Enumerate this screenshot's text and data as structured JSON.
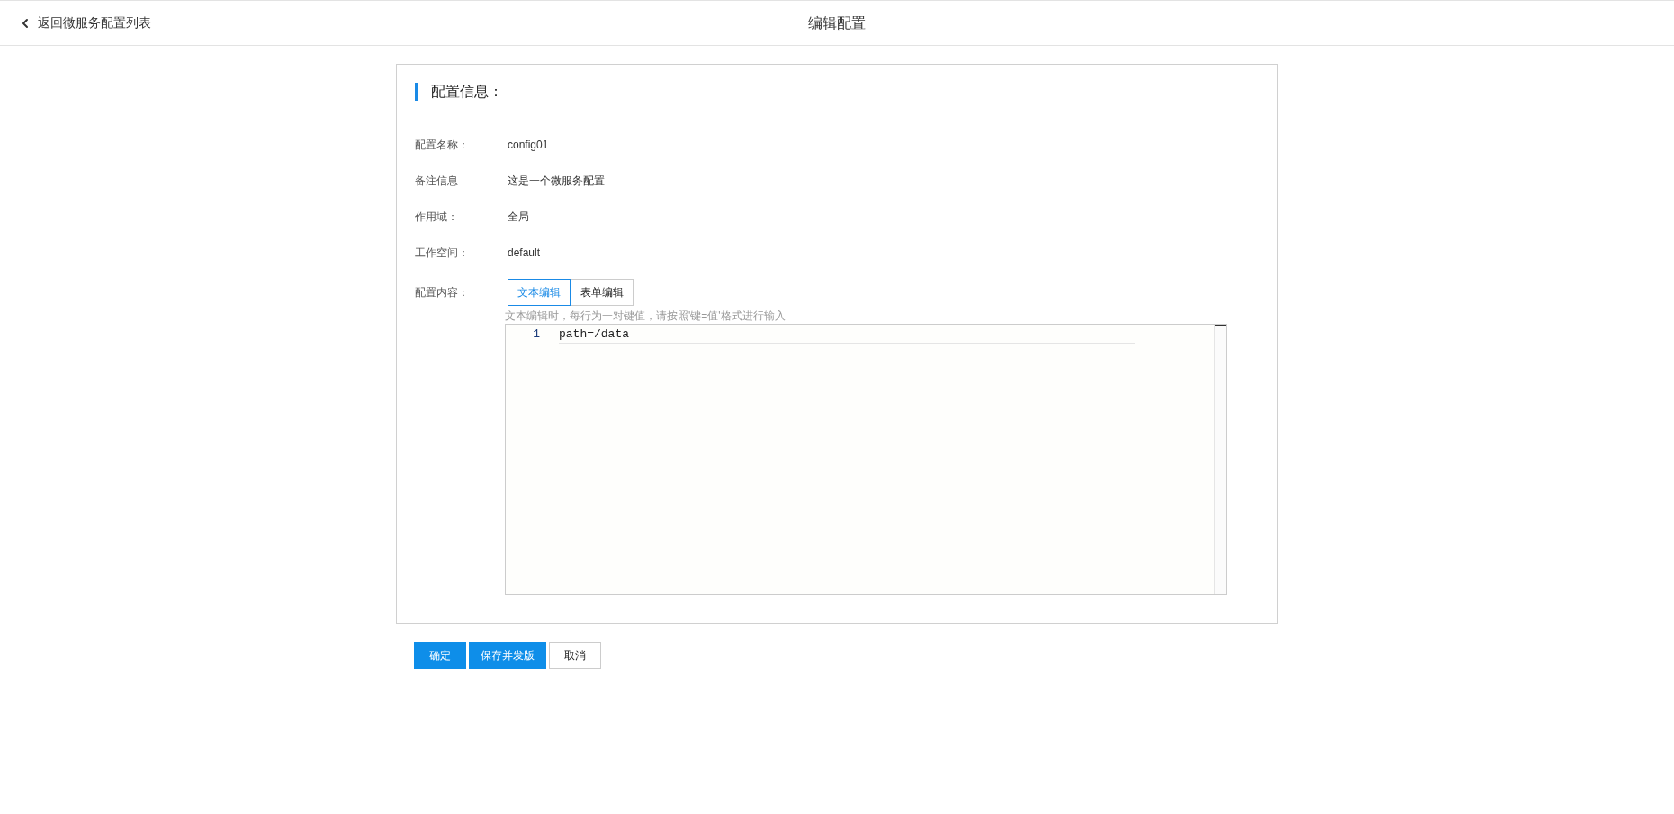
{
  "header": {
    "back_link": "返回微服务配置列表",
    "title": "编辑配置"
  },
  "section_title": "配置信息：",
  "fields": [
    {
      "label": "配置名称：",
      "value": "config01"
    },
    {
      "label": "备注信息",
      "value": "这是一个微服务配置"
    },
    {
      "label": "作用域：",
      "value": "全局"
    },
    {
      "label": "工作空间：",
      "value": "default"
    }
  ],
  "content": {
    "label": "配置内容：",
    "tabs": [
      {
        "label": "文本编辑",
        "selected": true
      },
      {
        "label": "表单编辑",
        "selected": false
      }
    ],
    "hint": "文本编辑时，每行为一对键值，请按照'键=值'格式进行输入",
    "editor_lines": [
      {
        "number": "1",
        "text": "path=/data"
      }
    ]
  },
  "buttons": [
    {
      "label": "确定",
      "kind": "primary"
    },
    {
      "label": "保存并发版",
      "kind": "primary"
    },
    {
      "label": "取消",
      "kind": "default"
    }
  ]
}
